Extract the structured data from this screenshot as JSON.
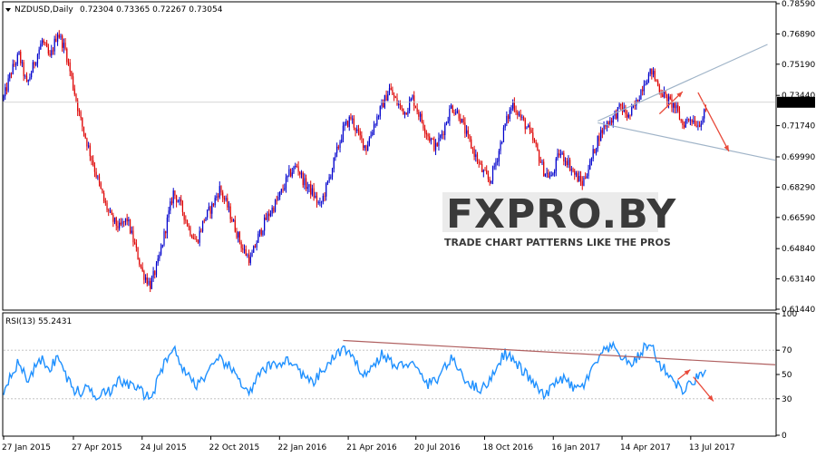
{
  "chart_data": [
    {
      "type": "candlestick",
      "symbol_label": "NZDUSD,Daily",
      "ohlc_label": "0.72304 0.73365 0.72267 0.73054",
      "last_price_label": "0.73054",
      "ylim": [
        0.6144,
        0.7859
      ],
      "y_ticks": [
        "0.78590",
        "0.76890",
        "0.75190",
        "0.73440",
        "0.71740",
        "0.69990",
        "0.68290",
        "0.66590",
        "0.64840",
        "0.63140",
        "0.61440"
      ],
      "x_tick_labels": [
        "27 Jan 2015",
        "27 Apr 2015",
        "24 Jul 2015",
        "22 Oct 2015",
        "22 Jan 2016",
        "21 Apr 2016",
        "20 Jul 2016",
        "18 Oct 2016",
        "16 Jan 2017",
        "14 Apr 2017",
        "13 Jul 2017"
      ],
      "bull_color": "#0000cc",
      "bear_color": "#dd0000",
      "price_path": [
        {
          "x": 0,
          "y": 0.733
        },
        {
          "x": 5,
          "y": 0.748
        },
        {
          "x": 10,
          "y": 0.757
        },
        {
          "x": 15,
          "y": 0.74
        },
        {
          "x": 20,
          "y": 0.753
        },
        {
          "x": 25,
          "y": 0.765
        },
        {
          "x": 30,
          "y": 0.755
        },
        {
          "x": 35,
          "y": 0.77
        },
        {
          "x": 40,
          "y": 0.76
        },
        {
          "x": 45,
          "y": 0.74
        },
        {
          "x": 50,
          "y": 0.72
        },
        {
          "x": 55,
          "y": 0.705
        },
        {
          "x": 60,
          "y": 0.69
        },
        {
          "x": 65,
          "y": 0.675
        },
        {
          "x": 70,
          "y": 0.665
        },
        {
          "x": 75,
          "y": 0.66
        },
        {
          "x": 80,
          "y": 0.665
        },
        {
          "x": 85,
          "y": 0.65
        },
        {
          "x": 90,
          "y": 0.635
        },
        {
          "x": 95,
          "y": 0.628
        },
        {
          "x": 100,
          "y": 0.64
        },
        {
          "x": 105,
          "y": 0.66
        },
        {
          "x": 110,
          "y": 0.68
        },
        {
          "x": 115,
          "y": 0.672
        },
        {
          "x": 120,
          "y": 0.66
        },
        {
          "x": 125,
          "y": 0.652
        },
        {
          "x": 130,
          "y": 0.665
        },
        {
          "x": 135,
          "y": 0.672
        },
        {
          "x": 140,
          "y": 0.682
        },
        {
          "x": 145,
          "y": 0.672
        },
        {
          "x": 150,
          "y": 0.66
        },
        {
          "x": 155,
          "y": 0.648
        },
        {
          "x": 160,
          "y": 0.642
        },
        {
          "x": 165,
          "y": 0.655
        },
        {
          "x": 170,
          "y": 0.665
        },
        {
          "x": 175,
          "y": 0.672
        },
        {
          "x": 180,
          "y": 0.68
        },
        {
          "x": 185,
          "y": 0.69
        },
        {
          "x": 190,
          "y": 0.695
        },
        {
          "x": 195,
          "y": 0.685
        },
        {
          "x": 200,
          "y": 0.68
        },
        {
          "x": 205,
          "y": 0.672
        },
        {
          "x": 210,
          "y": 0.685
        },
        {
          "x": 215,
          "y": 0.7
        },
        {
          "x": 220,
          "y": 0.715
        },
        {
          "x": 225,
          "y": 0.722
        },
        {
          "x": 230,
          "y": 0.712
        },
        {
          "x": 235,
          "y": 0.705
        },
        {
          "x": 240,
          "y": 0.718
        },
        {
          "x": 245,
          "y": 0.728
        },
        {
          "x": 250,
          "y": 0.738
        },
        {
          "x": 255,
          "y": 0.73
        },
        {
          "x": 260,
          "y": 0.725
        },
        {
          "x": 265,
          "y": 0.733
        },
        {
          "x": 270,
          "y": 0.722
        },
        {
          "x": 275,
          "y": 0.712
        },
        {
          "x": 280,
          "y": 0.705
        },
        {
          "x": 285,
          "y": 0.715
        },
        {
          "x": 290,
          "y": 0.728
        },
        {
          "x": 295,
          "y": 0.724
        },
        {
          "x": 300,
          "y": 0.712
        },
        {
          "x": 305,
          "y": 0.702
        },
        {
          "x": 310,
          "y": 0.692
        },
        {
          "x": 315,
          "y": 0.686
        },
        {
          "x": 320,
          "y": 0.7
        },
        {
          "x": 325,
          "y": 0.718
        },
        {
          "x": 330,
          "y": 0.73
        },
        {
          "x": 335,
          "y": 0.722
        },
        {
          "x": 340,
          "y": 0.715
        },
        {
          "x": 345,
          "y": 0.705
        },
        {
          "x": 350,
          "y": 0.692
        },
        {
          "x": 355,
          "y": 0.688
        },
        {
          "x": 360,
          "y": 0.702
        },
        {
          "x": 365,
          "y": 0.698
        },
        {
          "x": 370,
          "y": 0.69
        },
        {
          "x": 375,
          "y": 0.685
        },
        {
          "x": 380,
          "y": 0.696
        },
        {
          "x": 385,
          "y": 0.71
        },
        {
          "x": 390,
          "y": 0.718
        },
        {
          "x": 395,
          "y": 0.722
        },
        {
          "x": 400,
          "y": 0.728
        },
        {
          "x": 405,
          "y": 0.722
        },
        {
          "x": 410,
          "y": 0.73
        },
        {
          "x": 415,
          "y": 0.742
        },
        {
          "x": 420,
          "y": 0.748
        },
        {
          "x": 425,
          "y": 0.738
        },
        {
          "x": 430,
          "y": 0.732
        },
        {
          "x": 435,
          "y": 0.728
        },
        {
          "x": 440,
          "y": 0.718
        },
        {
          "x": 445,
          "y": 0.722
        },
        {
          "x": 450,
          "y": 0.718
        },
        {
          "x": 455,
          "y": 0.725
        }
      ],
      "pattern_lines": [
        {
          "x0": 385,
          "y0": 0.72,
          "x1": 495,
          "y1": 0.763,
          "color": "#a0b4c8"
        },
        {
          "x0": 385,
          "y0": 0.719,
          "x1": 500,
          "y1": 0.698,
          "color": "#a0b4c8"
        }
      ],
      "arrows": [
        {
          "x0": 425,
          "y0": 0.724,
          "x1": 440,
          "y1": 0.7365,
          "color": "#e84a3a"
        },
        {
          "x0": 450,
          "y0": 0.736,
          "x1": 470,
          "y1": 0.703,
          "color": "#e84a3a"
        }
      ],
      "watermark": {
        "main": "FXPRO.BY",
        "sub": "TRADE CHART PATTERNS LIKE THE PROS"
      }
    },
    {
      "type": "line",
      "label": "RSI(13) 55.2431",
      "ylim": [
        0,
        100
      ],
      "y_ticks": [
        "100",
        "70",
        "50",
        "30",
        "0"
      ],
      "line_color": "#1e90ff",
      "series": [
        {
          "x": 0,
          "y": 36
        },
        {
          "x": 5,
          "y": 52
        },
        {
          "x": 10,
          "y": 60
        },
        {
          "x": 15,
          "y": 45
        },
        {
          "x": 20,
          "y": 55
        },
        {
          "x": 25,
          "y": 62
        },
        {
          "x": 30,
          "y": 55
        },
        {
          "x": 35,
          "y": 65
        },
        {
          "x": 40,
          "y": 50
        },
        {
          "x": 45,
          "y": 38
        },
        {
          "x": 50,
          "y": 35
        },
        {
          "x": 55,
          "y": 40
        },
        {
          "x": 60,
          "y": 32
        },
        {
          "x": 65,
          "y": 38
        },
        {
          "x": 70,
          "y": 35
        },
        {
          "x": 75,
          "y": 45
        },
        {
          "x": 80,
          "y": 42
        },
        {
          "x": 85,
          "y": 40
        },
        {
          "x": 90,
          "y": 35
        },
        {
          "x": 95,
          "y": 30
        },
        {
          "x": 100,
          "y": 45
        },
        {
          "x": 105,
          "y": 63
        },
        {
          "x": 110,
          "y": 72
        },
        {
          "x": 115,
          "y": 58
        },
        {
          "x": 120,
          "y": 48
        },
        {
          "x": 125,
          "y": 42
        },
        {
          "x": 130,
          "y": 48
        },
        {
          "x": 135,
          "y": 55
        },
        {
          "x": 140,
          "y": 62
        },
        {
          "x": 145,
          "y": 58
        },
        {
          "x": 150,
          "y": 50
        },
        {
          "x": 155,
          "y": 42
        },
        {
          "x": 160,
          "y": 35
        },
        {
          "x": 165,
          "y": 48
        },
        {
          "x": 170,
          "y": 55
        },
        {
          "x": 175,
          "y": 58
        },
        {
          "x": 180,
          "y": 60
        },
        {
          "x": 185,
          "y": 62
        },
        {
          "x": 190,
          "y": 55
        },
        {
          "x": 195,
          "y": 48
        },
        {
          "x": 200,
          "y": 42
        },
        {
          "x": 205,
          "y": 50
        },
        {
          "x": 210,
          "y": 58
        },
        {
          "x": 215,
          "y": 65
        },
        {
          "x": 220,
          "y": 72
        },
        {
          "x": 225,
          "y": 64
        },
        {
          "x": 230,
          "y": 56
        },
        {
          "x": 235,
          "y": 50
        },
        {
          "x": 240,
          "y": 58
        },
        {
          "x": 245,
          "y": 66
        },
        {
          "x": 250,
          "y": 62
        },
        {
          "x": 255,
          "y": 55
        },
        {
          "x": 260,
          "y": 60
        },
        {
          "x": 265,
          "y": 58
        },
        {
          "x": 270,
          "y": 50
        },
        {
          "x": 275,
          "y": 42
        },
        {
          "x": 280,
          "y": 45
        },
        {
          "x": 285,
          "y": 55
        },
        {
          "x": 290,
          "y": 62
        },
        {
          "x": 295,
          "y": 55
        },
        {
          "x": 300,
          "y": 45
        },
        {
          "x": 305,
          "y": 40
        },
        {
          "x": 310,
          "y": 38
        },
        {
          "x": 315,
          "y": 45
        },
        {
          "x": 320,
          "y": 58
        },
        {
          "x": 325,
          "y": 68
        },
        {
          "x": 330,
          "y": 62
        },
        {
          "x": 335,
          "y": 55
        },
        {
          "x": 340,
          "y": 48
        },
        {
          "x": 345,
          "y": 40
        },
        {
          "x": 350,
          "y": 32
        },
        {
          "x": 355,
          "y": 38
        },
        {
          "x": 360,
          "y": 48
        },
        {
          "x": 365,
          "y": 44
        },
        {
          "x": 370,
          "y": 38
        },
        {
          "x": 375,
          "y": 40
        },
        {
          "x": 380,
          "y": 50
        },
        {
          "x": 385,
          "y": 62
        },
        {
          "x": 390,
          "y": 70
        },
        {
          "x": 395,
          "y": 72
        },
        {
          "x": 400,
          "y": 66
        },
        {
          "x": 405,
          "y": 58
        },
        {
          "x": 410,
          "y": 62
        },
        {
          "x": 415,
          "y": 72
        },
        {
          "x": 420,
          "y": 74
        },
        {
          "x": 425,
          "y": 58
        },
        {
          "x": 430,
          "y": 52
        },
        {
          "x": 435,
          "y": 44
        },
        {
          "x": 440,
          "y": 36
        },
        {
          "x": 445,
          "y": 42
        },
        {
          "x": 450,
          "y": 48
        },
        {
          "x": 455,
          "y": 55
        }
      ],
      "trendline": {
        "x0": 220,
        "y0": 78,
        "x1": 500,
        "y1": 58,
        "color": "#b06060"
      },
      "arrows": [
        {
          "x0": 437,
          "y0": 46,
          "x1": 445,
          "y1": 54,
          "color": "#e84a3a"
        },
        {
          "x0": 447,
          "y0": 48,
          "x1": 460,
          "y1": 28,
          "color": "#e84a3a"
        }
      ]
    }
  ]
}
